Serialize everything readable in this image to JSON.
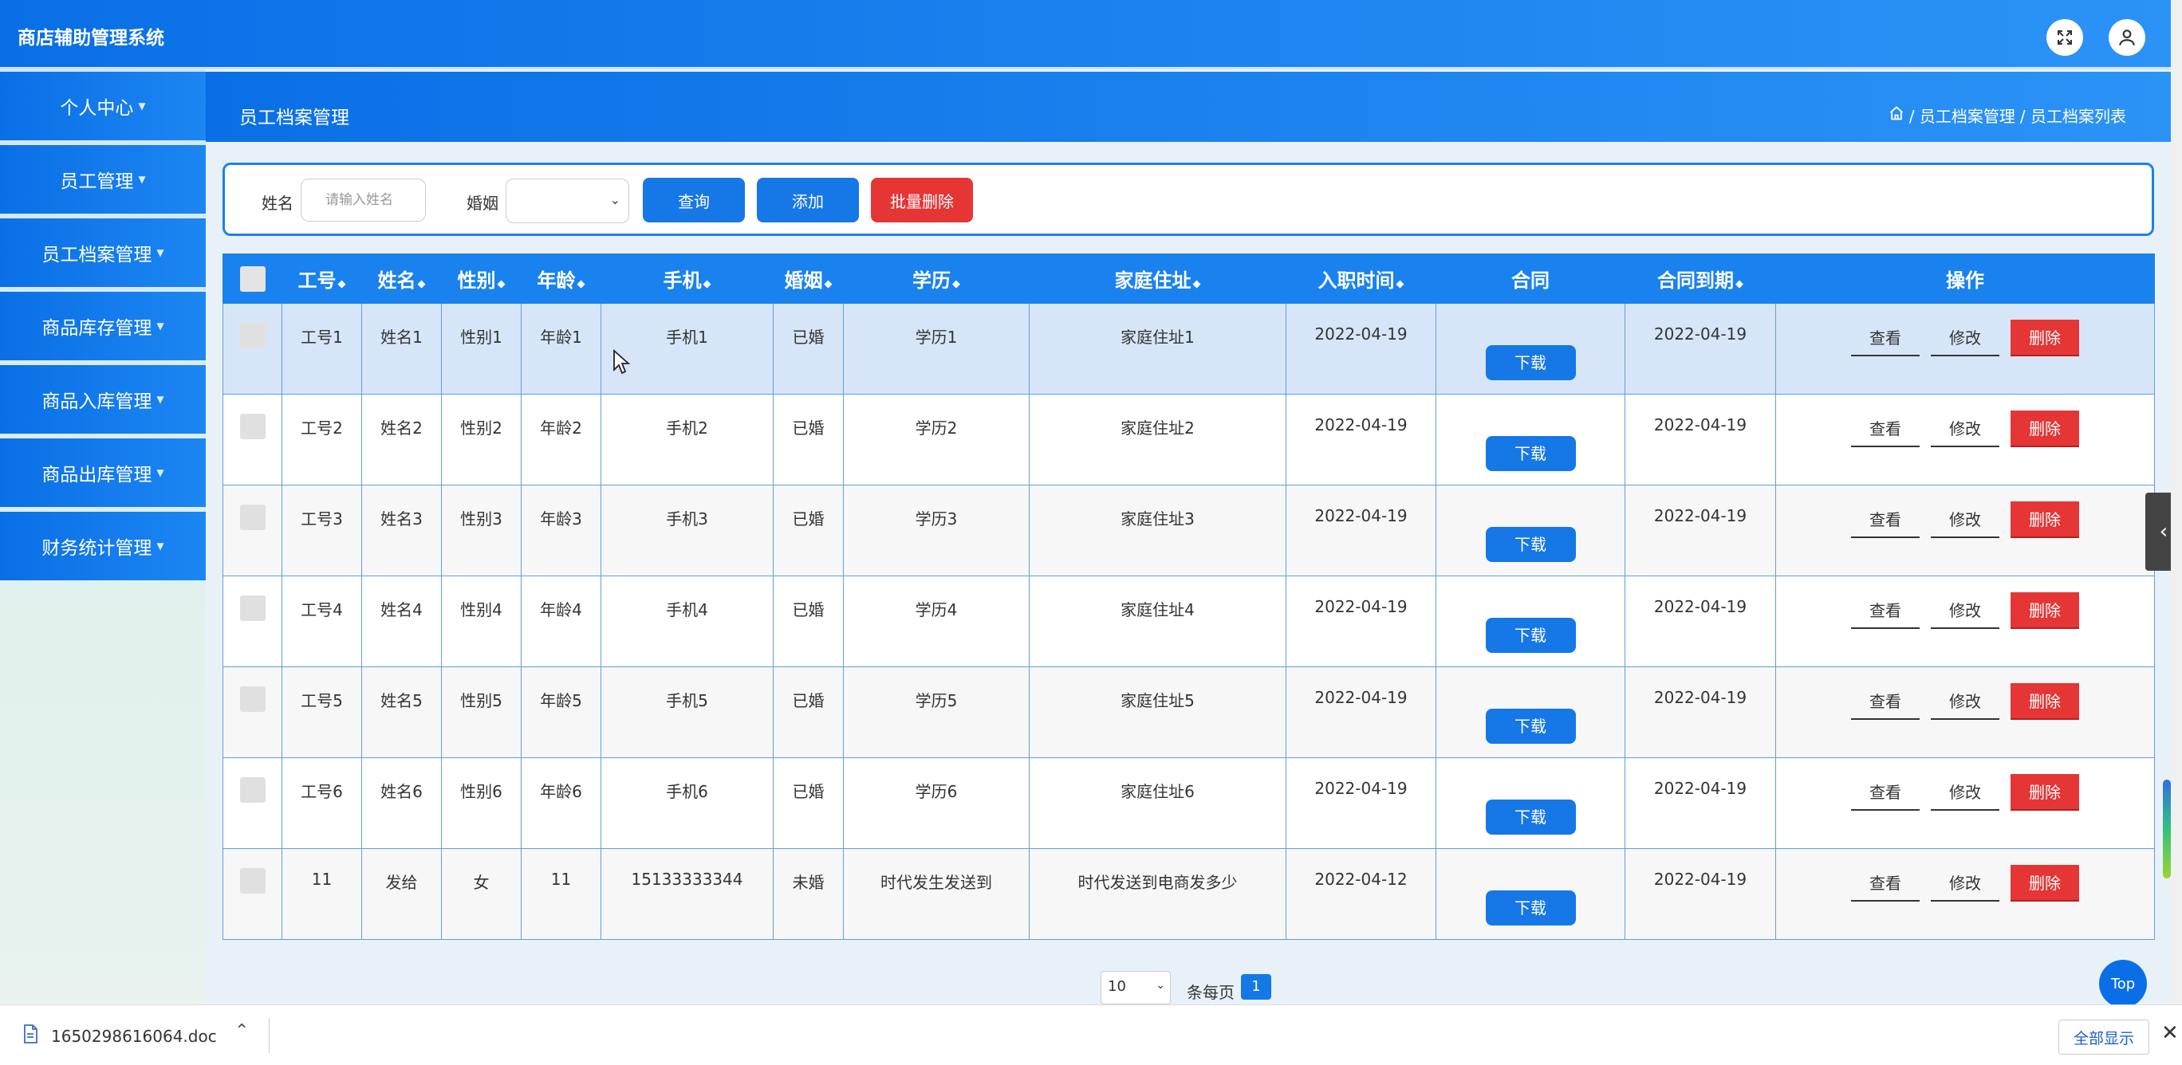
{
  "app": {
    "title": "商店辅助管理系统"
  },
  "sidebar": {
    "items": [
      {
        "label": "个人中心"
      },
      {
        "label": "员工管理"
      },
      {
        "label": "员工档案管理"
      },
      {
        "label": "商品库存管理"
      },
      {
        "label": "商品入库管理"
      },
      {
        "label": "商品出库管理"
      },
      {
        "label": "财务统计管理"
      }
    ]
  },
  "header": {
    "page_title": "员工档案管理",
    "breadcrumb": [
      "/ 员工档案管理",
      "/ 员工档案列表"
    ]
  },
  "search": {
    "name_label": "姓名",
    "name_placeholder": "请输入姓名",
    "marriage_label": "婚姻",
    "query_label": "查询",
    "add_label": "添加",
    "batch_delete_label": "批量删除"
  },
  "table": {
    "columns": [
      "工号",
      "姓名",
      "性别",
      "年龄",
      "手机",
      "婚姻",
      "学历",
      "家庭住址",
      "入职时间",
      "合同",
      "合同到期",
      "操作"
    ],
    "download_label": "下载",
    "view_label": "查看",
    "edit_label": "修改",
    "delete_label": "删除",
    "rows": [
      {
        "id": "工号1",
        "name": "姓名1",
        "gender": "性别1",
        "age": "年龄1",
        "phone": "手机1",
        "marriage": "已婚",
        "education": "学历1",
        "address": "家庭住址1",
        "hire_date": "2022-04-19",
        "contract_end": "2022-04-19"
      },
      {
        "id": "工号2",
        "name": "姓名2",
        "gender": "性别2",
        "age": "年龄2",
        "phone": "手机2",
        "marriage": "已婚",
        "education": "学历2",
        "address": "家庭住址2",
        "hire_date": "2022-04-19",
        "contract_end": "2022-04-19"
      },
      {
        "id": "工号3",
        "name": "姓名3",
        "gender": "性别3",
        "age": "年龄3",
        "phone": "手机3",
        "marriage": "已婚",
        "education": "学历3",
        "address": "家庭住址3",
        "hire_date": "2022-04-19",
        "contract_end": "2022-04-19"
      },
      {
        "id": "工号4",
        "name": "姓名4",
        "gender": "性别4",
        "age": "年龄4",
        "phone": "手机4",
        "marriage": "已婚",
        "education": "学历4",
        "address": "家庭住址4",
        "hire_date": "2022-04-19",
        "contract_end": "2022-04-19"
      },
      {
        "id": "工号5",
        "name": "姓名5",
        "gender": "性别5",
        "age": "年龄5",
        "phone": "手机5",
        "marriage": "已婚",
        "education": "学历5",
        "address": "家庭住址5",
        "hire_date": "2022-04-19",
        "contract_end": "2022-04-19"
      },
      {
        "id": "工号6",
        "name": "姓名6",
        "gender": "性别6",
        "age": "年龄6",
        "phone": "手机6",
        "marriage": "已婚",
        "education": "学历6",
        "address": "家庭住址6",
        "hire_date": "2022-04-19",
        "contract_end": "2022-04-19"
      },
      {
        "id": "11",
        "name": "发给",
        "gender": "女",
        "age": "11",
        "phone": "15133333344",
        "marriage": "未婚",
        "education": "时代发生发送到",
        "address": "时代发送到电商发多少",
        "hire_date": "2022-04-12",
        "contract_end": "2022-04-19"
      }
    ]
  },
  "pagination": {
    "page_size": "10",
    "per_page_label": "条每页",
    "current_page": "1",
    "top_label": "Top"
  },
  "download_bar": {
    "filename": "1650298616064.doc",
    "show_all_label": "全部显示"
  },
  "icons": {
    "fullscreen": "fullscreen-icon",
    "user": "user-icon",
    "home": "home-icon",
    "sort": "sort-icon",
    "doc": "doc-file-icon"
  },
  "colors": {
    "primary": "#1677e6",
    "danger": "#e53535",
    "header_blue": "#0a6fe6"
  }
}
